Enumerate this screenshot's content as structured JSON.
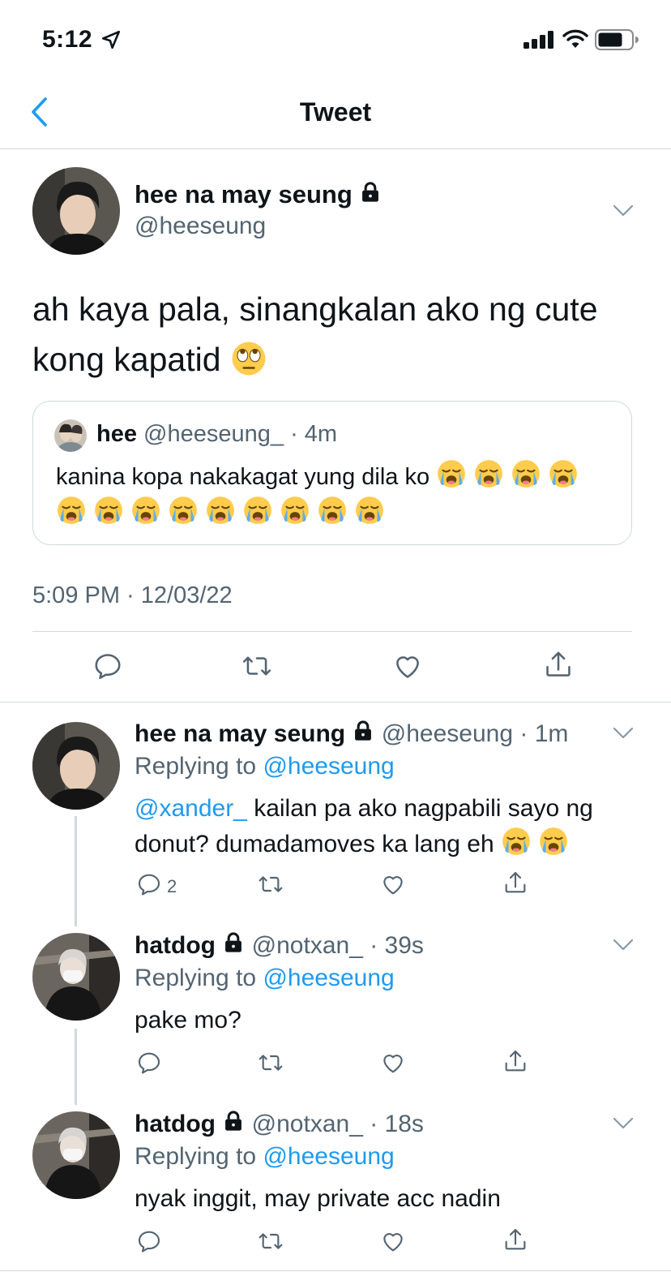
{
  "status_bar": {
    "time": "5:12"
  },
  "nav": {
    "title": "Tweet"
  },
  "main_tweet": {
    "author_name": "hee na may seung",
    "handle": "@heeseung",
    "text": "ah kaya pala, sinangkalan ako ng cute kong kapatid",
    "emoji": "face-with-rolling-eyes",
    "timestamp": "5:09 PM · 12/03/22"
  },
  "quoted_tweet": {
    "author_name": "hee",
    "meta": "@heeseung_ · 4m",
    "text": "kanina kopa nakakagat yung dila ko",
    "emoji": "loudly-crying-face",
    "emoji_count": 13
  },
  "replies": [
    {
      "author_name": "hee na may seung",
      "meta": "@heeseung · 1m",
      "replying_label": "Replying to",
      "replying_handle": "@heeseung",
      "mention": "@xander_",
      "text": " kailan pa ako nagpabili sayo ng donut? dumadamoves ka lang eh",
      "emoji_count": 2,
      "reply_count": "2"
    },
    {
      "author_name": "hatdog",
      "meta": "@notxan_ · 39s",
      "replying_label": "Replying to",
      "replying_handle": "@heeseung",
      "text": "pake mo?"
    },
    {
      "author_name": "hatdog",
      "meta": "@notxan_ · 18s",
      "replying_label": "Replying to",
      "replying_handle": "@heeseung",
      "text": "nyak inggit, may private acc nadin"
    }
  ],
  "colors": {
    "accent": "#1d9bf0",
    "secondary_text": "#536471",
    "divider": "#cfd9de",
    "nav_back": "#1d9bf0"
  },
  "icons": [
    "location-arrow-icon",
    "signal-icon",
    "wifi-icon",
    "battery-icon",
    "back-chevron-icon",
    "lock-icon",
    "chevron-down-icon",
    "reply-icon",
    "retweet-icon",
    "like-icon",
    "share-icon"
  ]
}
